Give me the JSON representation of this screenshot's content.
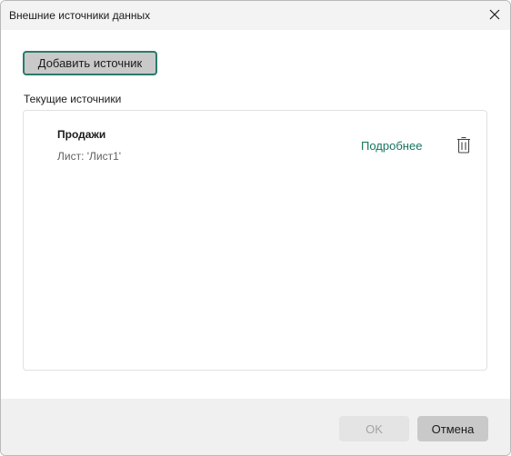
{
  "dialog": {
    "title": "Внешние источники данных",
    "close_icon": "close-icon"
  },
  "toolbar": {
    "add_source_label": "Добавить источник"
  },
  "sources": {
    "section_label": "Текущие источники",
    "items": [
      {
        "name": "Продажи",
        "sheet": "Лист: 'Лист1'",
        "details_label": "Подробнее",
        "delete_icon": "trash-icon"
      }
    ]
  },
  "footer": {
    "ok_label": "OK",
    "ok_enabled": false,
    "cancel_label": "Отмена"
  },
  "colors": {
    "accent": "#17745f",
    "focus_border": "#2a7a6c",
    "button_gray": "#c9c9c9",
    "footer_bg": "#f0f0f0"
  }
}
